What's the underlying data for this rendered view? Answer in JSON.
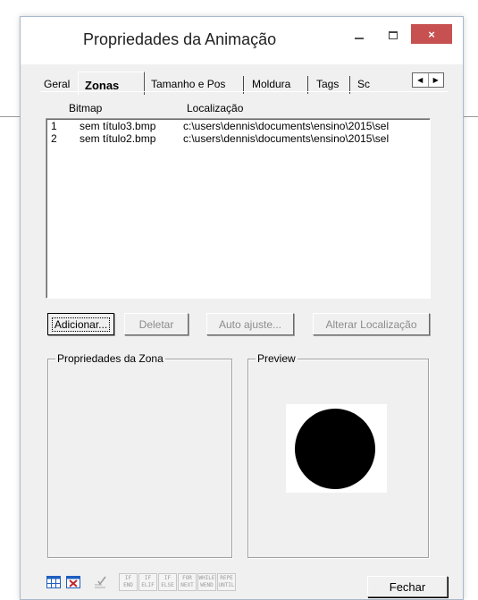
{
  "window": {
    "title": "Propriedades da Animação",
    "minimize_glyph": "–",
    "close_glyph": "×"
  },
  "tabs": {
    "items": [
      "Geral",
      "Zonas",
      "Tamanho e Pos",
      "Moldura",
      "Tags",
      "Sc"
    ],
    "active": "Zonas",
    "scroll_left": "◀",
    "scroll_right": "▶"
  },
  "list": {
    "columns": [
      "Bitmap",
      "Localização"
    ],
    "rows": [
      {
        "index": "1",
        "bitmap": "sem título3.bmp",
        "location": "c:\\users\\dennis\\documents\\ensino\\2015\\sel"
      },
      {
        "index": "2",
        "bitmap": "sem título2.bmp",
        "location": "c:\\users\\dennis\\documents\\ensino\\2015\\sel"
      }
    ]
  },
  "buttons": {
    "add": "Adicionar...",
    "delete": "Deletar",
    "auto_fit": "Auto ajuste...",
    "change_location": "Alterar Localização"
  },
  "groups": {
    "zone_properties": "Propriedades da Zona",
    "preview": "Preview"
  },
  "footer": {
    "keywords": [
      [
        "IF",
        "END"
      ],
      [
        "IF",
        "ELIF"
      ],
      [
        "IF",
        "ELSE"
      ],
      [
        "FOR",
        "NEXT"
      ],
      [
        "WHILE",
        "WEND"
      ],
      [
        "REPE",
        "UNTIL"
      ]
    ],
    "close_button": "Fechar"
  },
  "colors": {
    "close_button_bg": "#c75050",
    "dialog_bg": "#f0f0f0",
    "icon_blue": "#1f5fbf",
    "icon_red": "#c0242a"
  }
}
